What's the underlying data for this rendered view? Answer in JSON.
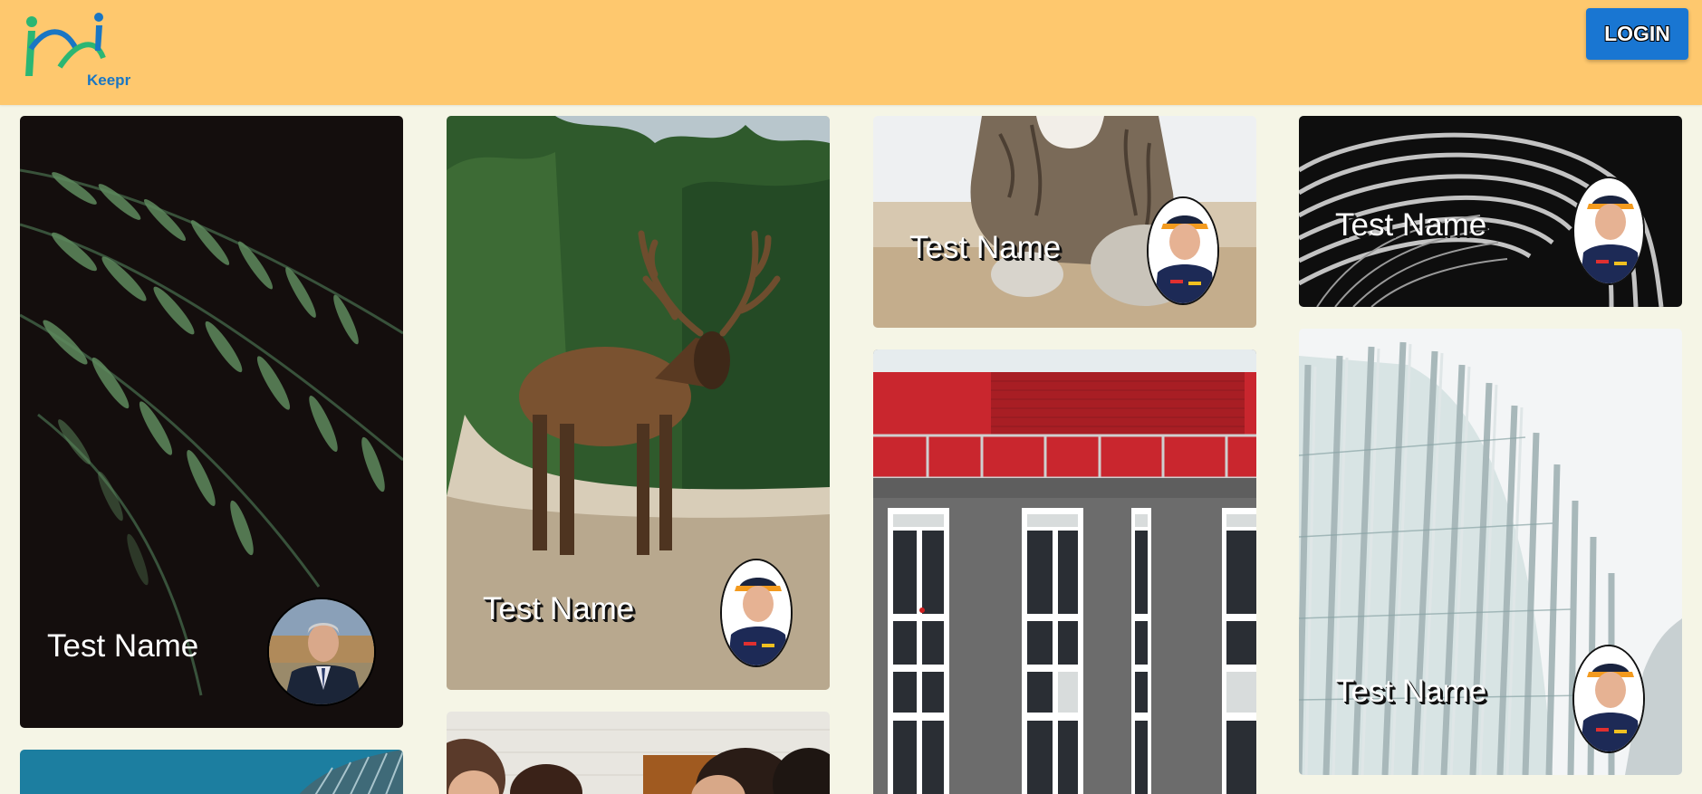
{
  "app": {
    "logo_text": "Keepr"
  },
  "header": {
    "login_label": "LOGIN"
  },
  "cards": [
    {
      "name": "Test Name",
      "image": "fern-leaves",
      "avatar": "man-in-suit-avatar"
    },
    {
      "name": "Test Name",
      "image": "elk-on-road",
      "avatar": "racing-driver-avatar"
    },
    {
      "name": "Test Name",
      "image": "cat-paws",
      "avatar": "racing-driver-avatar"
    },
    {
      "name": "Test Name",
      "image": "curved-architecture-black-white",
      "avatar": "racing-driver-avatar"
    },
    {
      "name": "Test Name",
      "image": "glass-fins-facade",
      "avatar": "racing-driver-avatar"
    },
    {
      "name": "",
      "image": "teal-building"
    },
    {
      "name": "",
      "image": "people-at-table"
    },
    {
      "name": "",
      "image": "red-grey-building"
    }
  ],
  "colors": {
    "navbar": "#fec86e",
    "page_background": "#f5f5e6",
    "login_button": "#1976d2"
  }
}
